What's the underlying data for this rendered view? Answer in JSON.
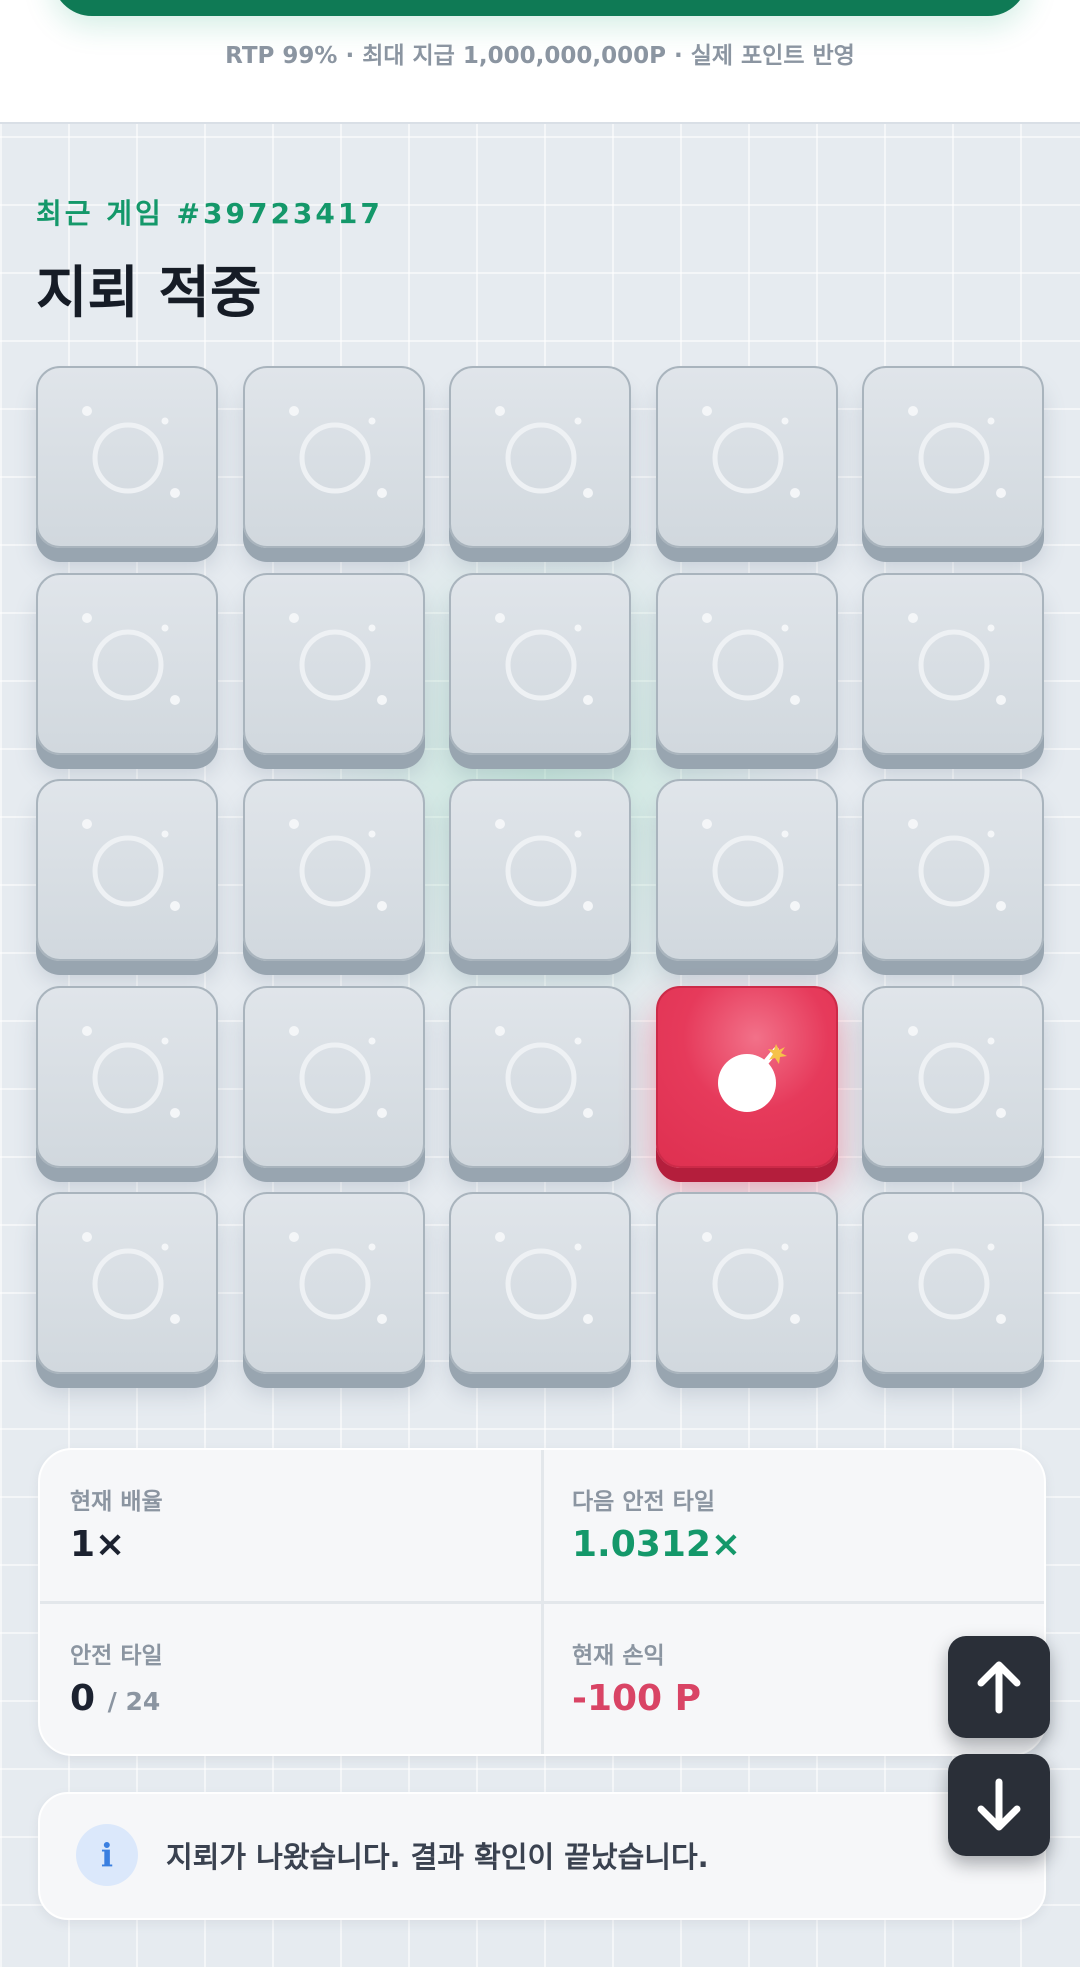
{
  "header": {
    "rtp_text": "RTP 99% · 최대 지급 1,000,000,000P · 실제 포인트 반영"
  },
  "game": {
    "eyebrow": "최근 게임 #39723417",
    "title": "지뢰 적중",
    "grid_rows": 5,
    "grid_cols": 5,
    "bomb_tile": {
      "row": 4,
      "col": 4
    }
  },
  "stats": {
    "current_multiplier_label": "현재 배율",
    "current_multiplier_value": "1×",
    "next_safe_label": "다음 안전 타일",
    "next_safe_value": "1.0312×",
    "safe_tiles_label": "안전 타일",
    "safe_tiles_value": "0",
    "safe_tiles_total": "/ 24",
    "current_pl_label": "현재 손익",
    "current_pl_value": "-100 P"
  },
  "message": {
    "icon": "info-icon",
    "text": "지뢰가 나왔습니다. 결과 확인이 끝났습니다."
  },
  "scroll": {
    "up_icon": "arrow-up-icon",
    "down_icon": "arrow-down-icon"
  },
  "colors": {
    "accent_green": "#14986a",
    "loss_red": "#d94465",
    "bomb_red": "#e63a5b"
  }
}
